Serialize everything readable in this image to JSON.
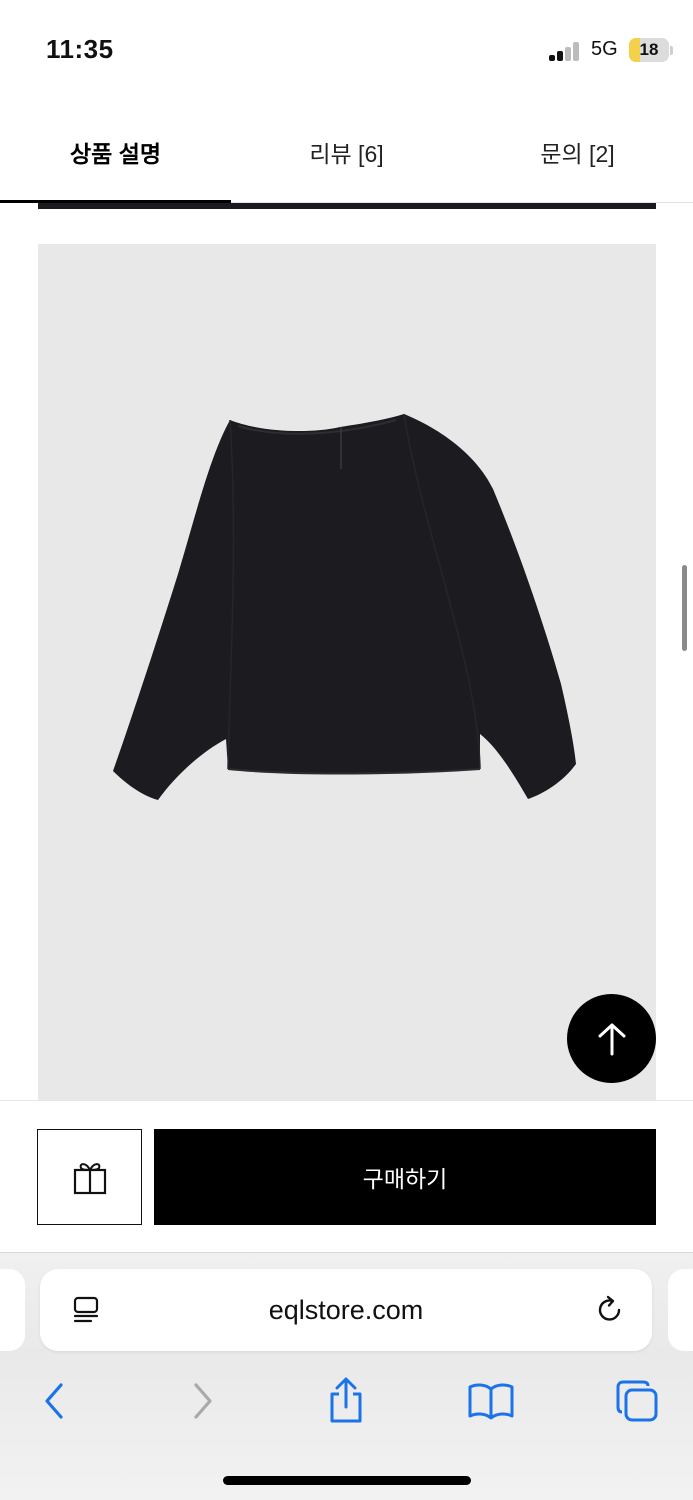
{
  "status_bar": {
    "time": "11:35",
    "network": "5G",
    "battery_level": "18",
    "battery_fraction": 0.18,
    "signal_bars_active": 2,
    "signal_bars_total": 4
  },
  "tabs": [
    {
      "label": "상품 설명",
      "active": true
    },
    {
      "label": "리뷰 [6]",
      "active": false
    },
    {
      "label": "문의 [2]",
      "active": false
    }
  ],
  "product": {
    "image_background": "#e8e8e8",
    "garment_color": "#1c1b20",
    "garment_icon": "long-sleeve-blouse"
  },
  "purchase_bar": {
    "gift_icon": "gift-icon",
    "buy_label": "구매하기"
  },
  "browser": {
    "url": "eqlstore.com",
    "accent_color": "#1a73e8",
    "toolbar_icons": [
      "back-icon",
      "forward-icon",
      "share-icon",
      "bookmarks-icon",
      "tabs-icon"
    ]
  },
  "colors": {
    "primary": "#000000",
    "text": "#111111",
    "safari_blue": "#1a73e8"
  }
}
